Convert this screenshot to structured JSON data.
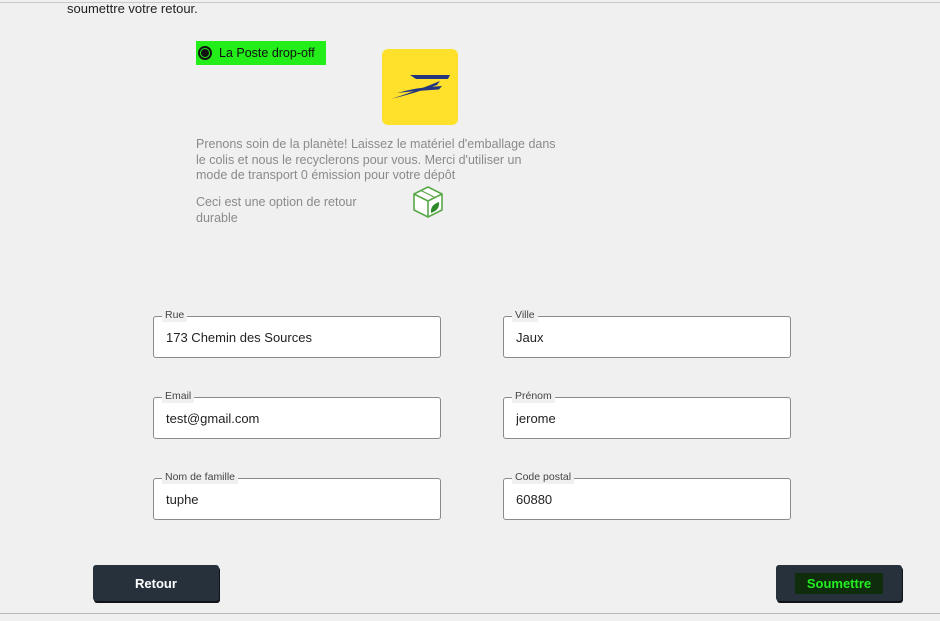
{
  "intro": {
    "text": "soumettre votre retour."
  },
  "shipping_option": {
    "label": "La Poste drop-off",
    "selected": true,
    "highlight_color": "#23ee1a",
    "logo_color": "#ffe12b",
    "logo_icon": "la-poste-logo"
  },
  "eco": {
    "description": "Prenons soin de la planète! Laissez le matériel d'emballage dans le colis et nous le recyclerons pour vous. Merci d'utiliser un mode de transport 0 émission pour votre dépôt",
    "sustainable_note": "Ceci est une option de retour durable",
    "icon": "eco-box-icon"
  },
  "form": {
    "street": {
      "label": "Rue",
      "value": "173 Chemin des Sources"
    },
    "city": {
      "label": "Ville",
      "value": "Jaux"
    },
    "email": {
      "label": "Email",
      "value": "test@gmail.com"
    },
    "first_name": {
      "label": "Prénom",
      "value": "jerome"
    },
    "last_name": {
      "label": "Nom de famille",
      "value": "tuphe"
    },
    "postal_code": {
      "label": "Code postal",
      "value": "60880"
    }
  },
  "buttons": {
    "back_label": "Retour",
    "submit_label": "Soumettre",
    "button_color": "#27313b"
  }
}
